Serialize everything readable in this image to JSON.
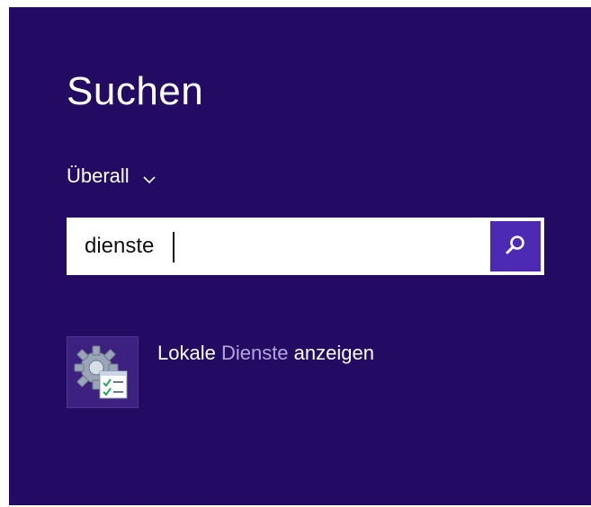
{
  "search": {
    "title": "Suchen",
    "scope": "Überall",
    "query": "dienste",
    "button_icon": "search-icon"
  },
  "results": [
    {
      "icon": "services-icon",
      "label_before": "Lokale ",
      "label_match": "Dienste",
      "label_after": " anzeigen"
    }
  ],
  "colors": {
    "background": "#230a63",
    "accent": "#4c2ab3",
    "match_highlight": "#b3a6de"
  }
}
